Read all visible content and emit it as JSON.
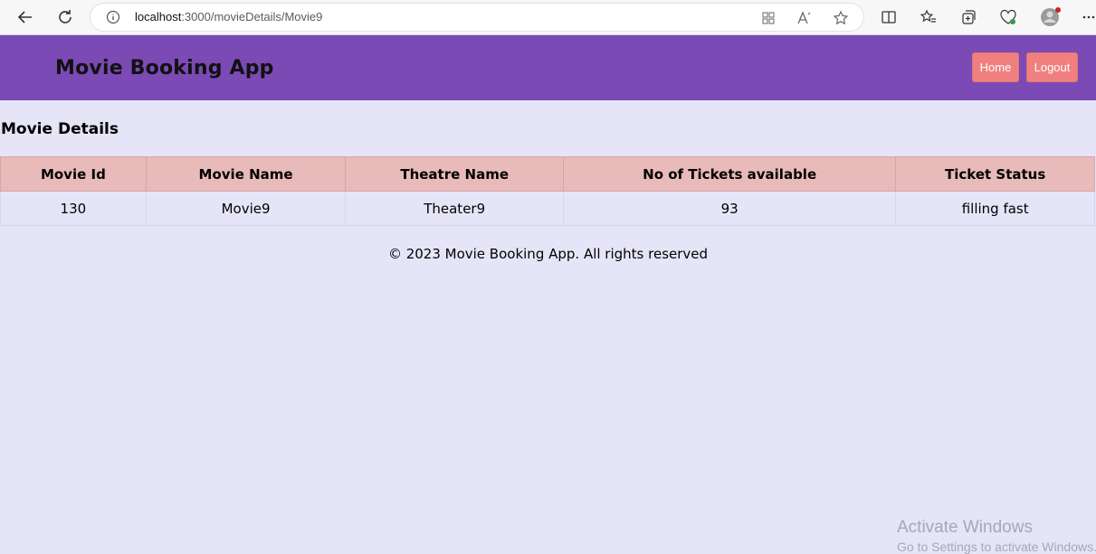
{
  "browser": {
    "url_host": "localhost",
    "url_path": ":3000/movieDetails/Movie9"
  },
  "header": {
    "title": "Movie Booking App",
    "home_label": "Home",
    "logout_label": "Logout",
    "background": "#7b4ab5",
    "button_color": "#f08080"
  },
  "main": {
    "section_title": "Movie Details",
    "table": {
      "headers": [
        "Movie Id",
        "Movie Name",
        "Theatre Name",
        "No of Tickets available",
        "Ticket Status"
      ],
      "rows": [
        [
          "130",
          "Movie9",
          "Theater9",
          "93",
          "filling fast"
        ]
      ]
    }
  },
  "footer": {
    "text": "© 2023 Movie Booking App. All rights reserved"
  },
  "watermark": {
    "line1": "Activate Windows",
    "line2": "Go to Settings to activate Windows."
  }
}
